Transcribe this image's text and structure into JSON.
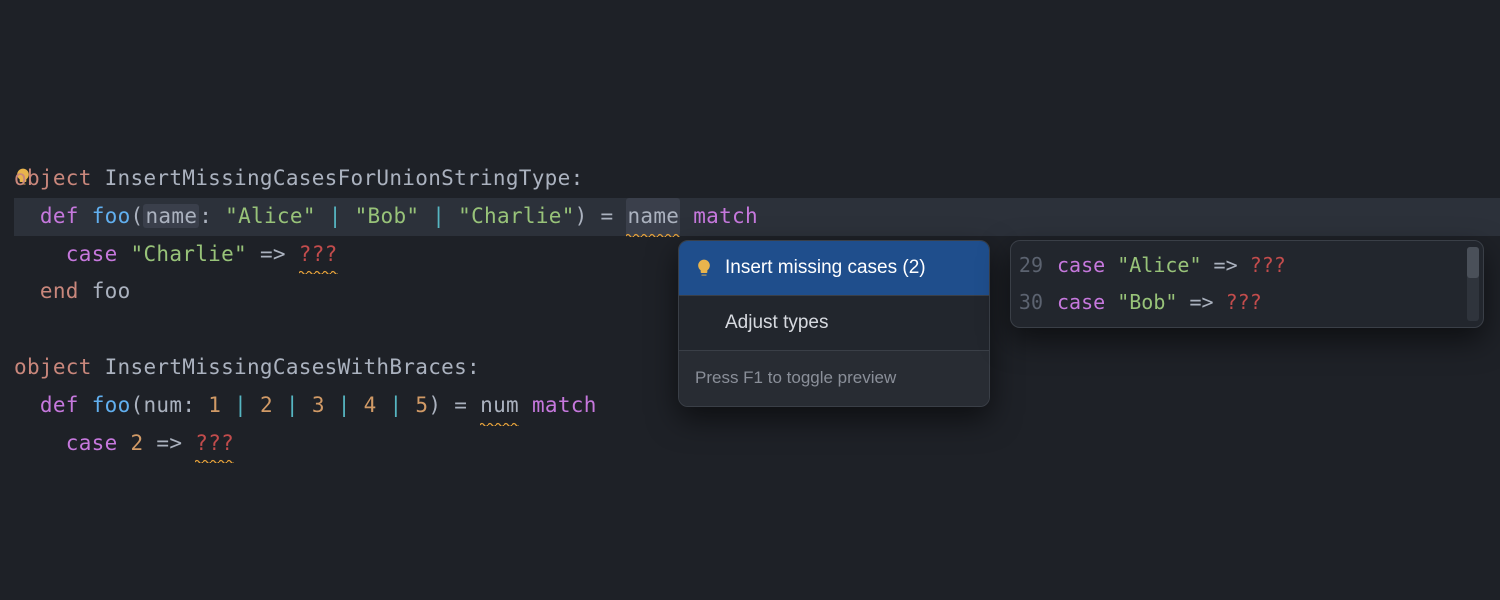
{
  "code": {
    "l1_object": "object",
    "l1_name": " InsertMissingCasesForUnionStringType:",
    "l2_indent": "  ",
    "l2_def": "def",
    "l2_sp1": " ",
    "l2_fn": "foo",
    "l2_open": "(",
    "l2_param": "name",
    "l2_colon": ": ",
    "l2_s1": "\"Alice\"",
    "l2_bar1": " | ",
    "l2_s2": "\"Bob\"",
    "l2_bar2": " | ",
    "l2_s3": "\"Charlie\"",
    "l2_close": ") = ",
    "l2_name2": "name",
    "l2_sp2": " ",
    "l2_match": "match",
    "l3_indent": "    ",
    "l3_case": "case",
    "l3_sp": " ",
    "l3_s": "\"Charlie\"",
    "l3_arrow": " => ",
    "l3_q": "???",
    "l4_indent": "  ",
    "l4_end": "end",
    "l4_sp": " ",
    "l4_foo": "foo",
    "l6_object": "object",
    "l6_name": " InsertMissingCasesWithBraces:",
    "l7_indent": "  ",
    "l7_def": "def",
    "l7_sp1": " ",
    "l7_fn": "foo",
    "l7_open": "(",
    "l7_param": "num",
    "l7_colon": ": ",
    "l7_n1": "1",
    "l7_b1": " | ",
    "l7_n2": "2",
    "l7_b2": " | ",
    "l7_n3": "3",
    "l7_b3": " | ",
    "l7_n4": "4",
    "l7_b4": " | ",
    "l7_n5": "5",
    "l7_close": ") = ",
    "l7_num2": "num",
    "l7_sp2": " ",
    "l7_match": "match",
    "l8_indent": "    ",
    "l8_case": "case",
    "l8_sp": " ",
    "l8_n": "2",
    "l8_arrow": " => ",
    "l8_q": "???"
  },
  "popup": {
    "item1": "Insert missing cases (2)",
    "item2": "Adjust types",
    "hint": "Press F1 to toggle preview"
  },
  "preview": {
    "lines": [
      {
        "num": "29",
        "case": "case",
        "sp": " ",
        "str": "\"Alice\"",
        "arrow": " => ",
        "q": "???"
      },
      {
        "num": "30",
        "case": "case",
        "sp": " ",
        "str": "\"Bob\"",
        "arrow": " => ",
        "q": "???"
      }
    ]
  },
  "icons": {
    "bulb": "lightbulb-icon"
  }
}
